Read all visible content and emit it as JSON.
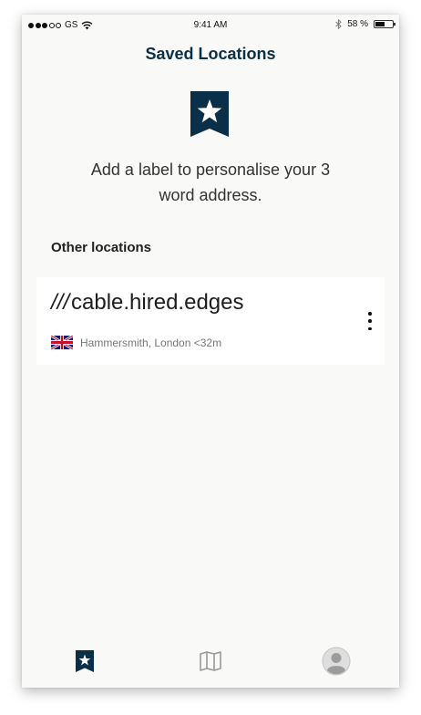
{
  "status_bar": {
    "carrier": "GS",
    "time": "9:41 AM",
    "battery": "58 %",
    "battery_level": 0.58
  },
  "header": {
    "title": "Saved Locations"
  },
  "empty_state": {
    "icon": "bookmark-star-icon",
    "message": "Add a label to personalise your 3 word address."
  },
  "sections": {
    "other_locations_heading": "Other locations"
  },
  "locations": [
    {
      "prefix": "///",
      "words": "cable.hired.edges",
      "country_flag": "uk-flag-icon",
      "nearest_place": "Hammersmith, London <32m"
    }
  ],
  "tab_bar": {
    "tabs": [
      "saved-tab",
      "map-tab",
      "profile-tab"
    ],
    "active": "saved-tab"
  },
  "colors": {
    "brand_navy": "#0a3049",
    "background": "#f9f9f8",
    "card": "#ffffff"
  }
}
